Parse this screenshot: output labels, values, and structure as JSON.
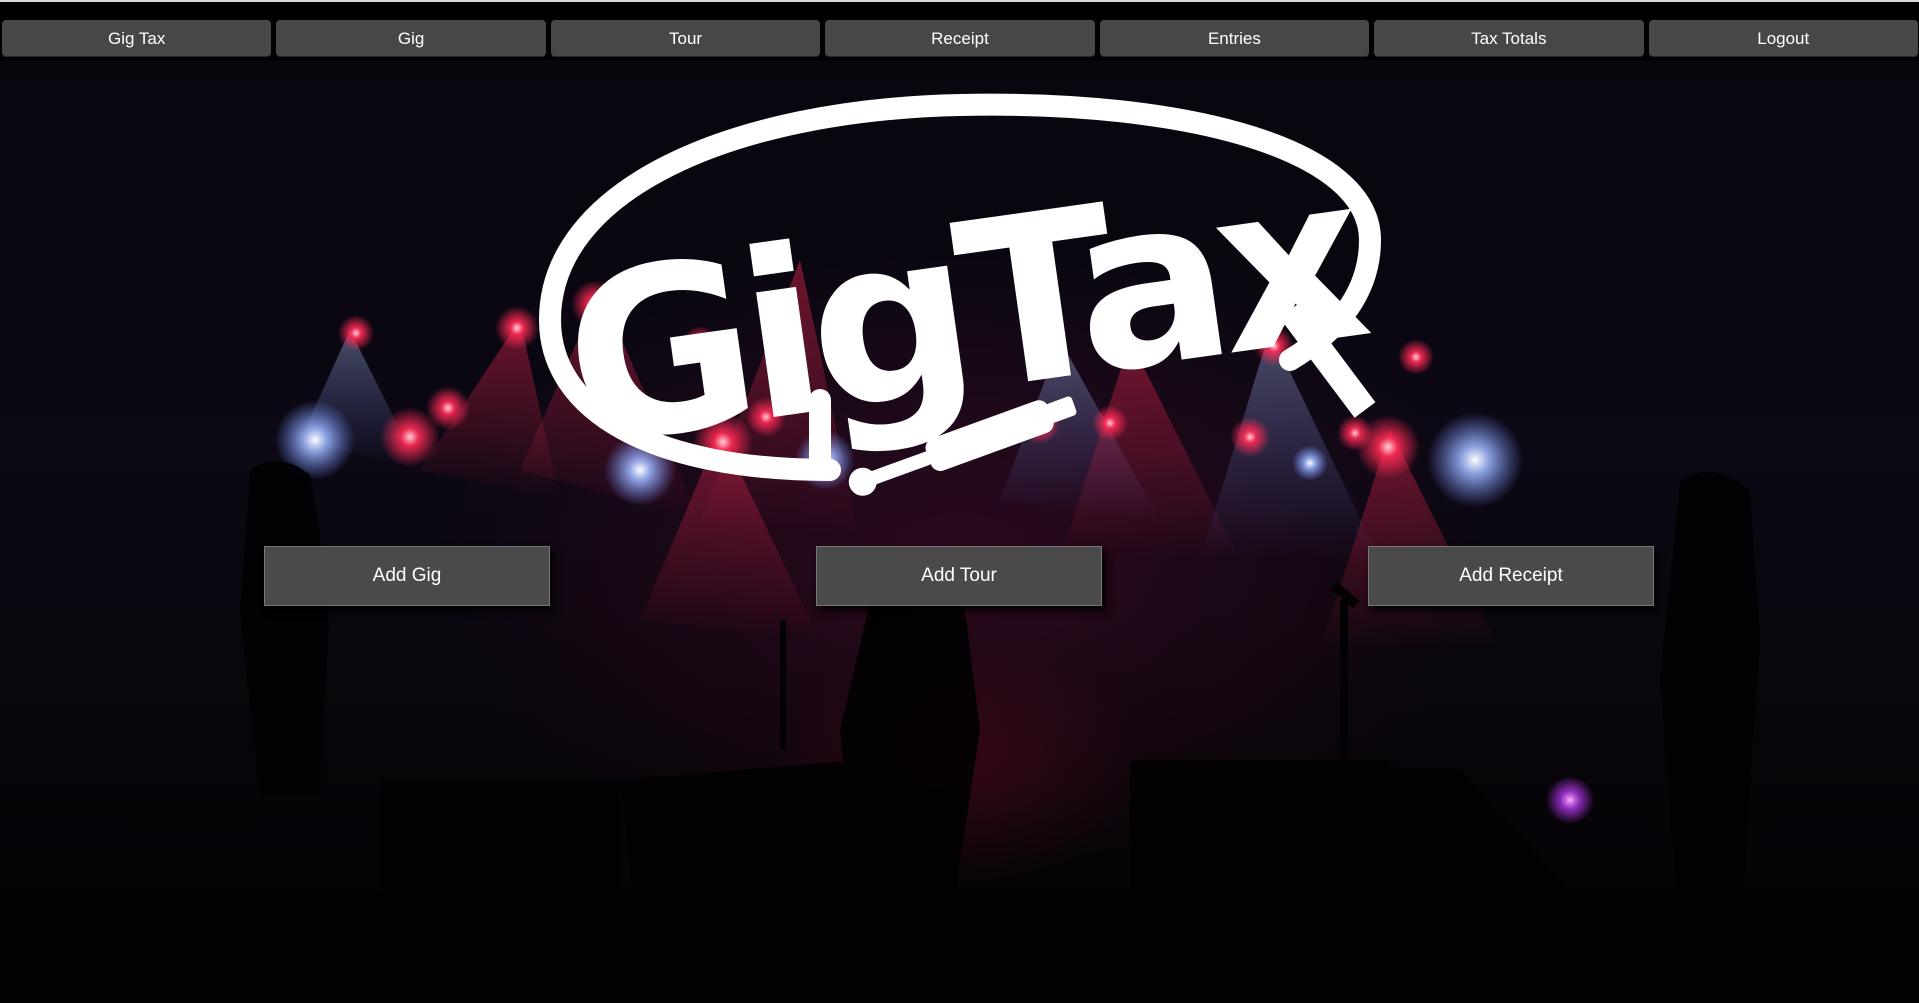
{
  "nav": {
    "items": [
      {
        "label": "Gig Tax"
      },
      {
        "label": "Gig"
      },
      {
        "label": "Tour"
      },
      {
        "label": "Receipt"
      },
      {
        "label": "Entries"
      },
      {
        "label": "Tax Totals"
      },
      {
        "label": "Logout"
      }
    ]
  },
  "logo": {
    "text": "GigTax",
    "color": "#ffffff"
  },
  "actions": {
    "add_gig": "Add Gig",
    "add_tour": "Add Tour",
    "add_receipt": "Add Receipt"
  },
  "theme": {
    "nav_button_bg": "#474747",
    "action_button_bg": "#4a4a4a",
    "spotlight_red": "#ff2a55",
    "spotlight_blue": "#9fb8ff"
  }
}
